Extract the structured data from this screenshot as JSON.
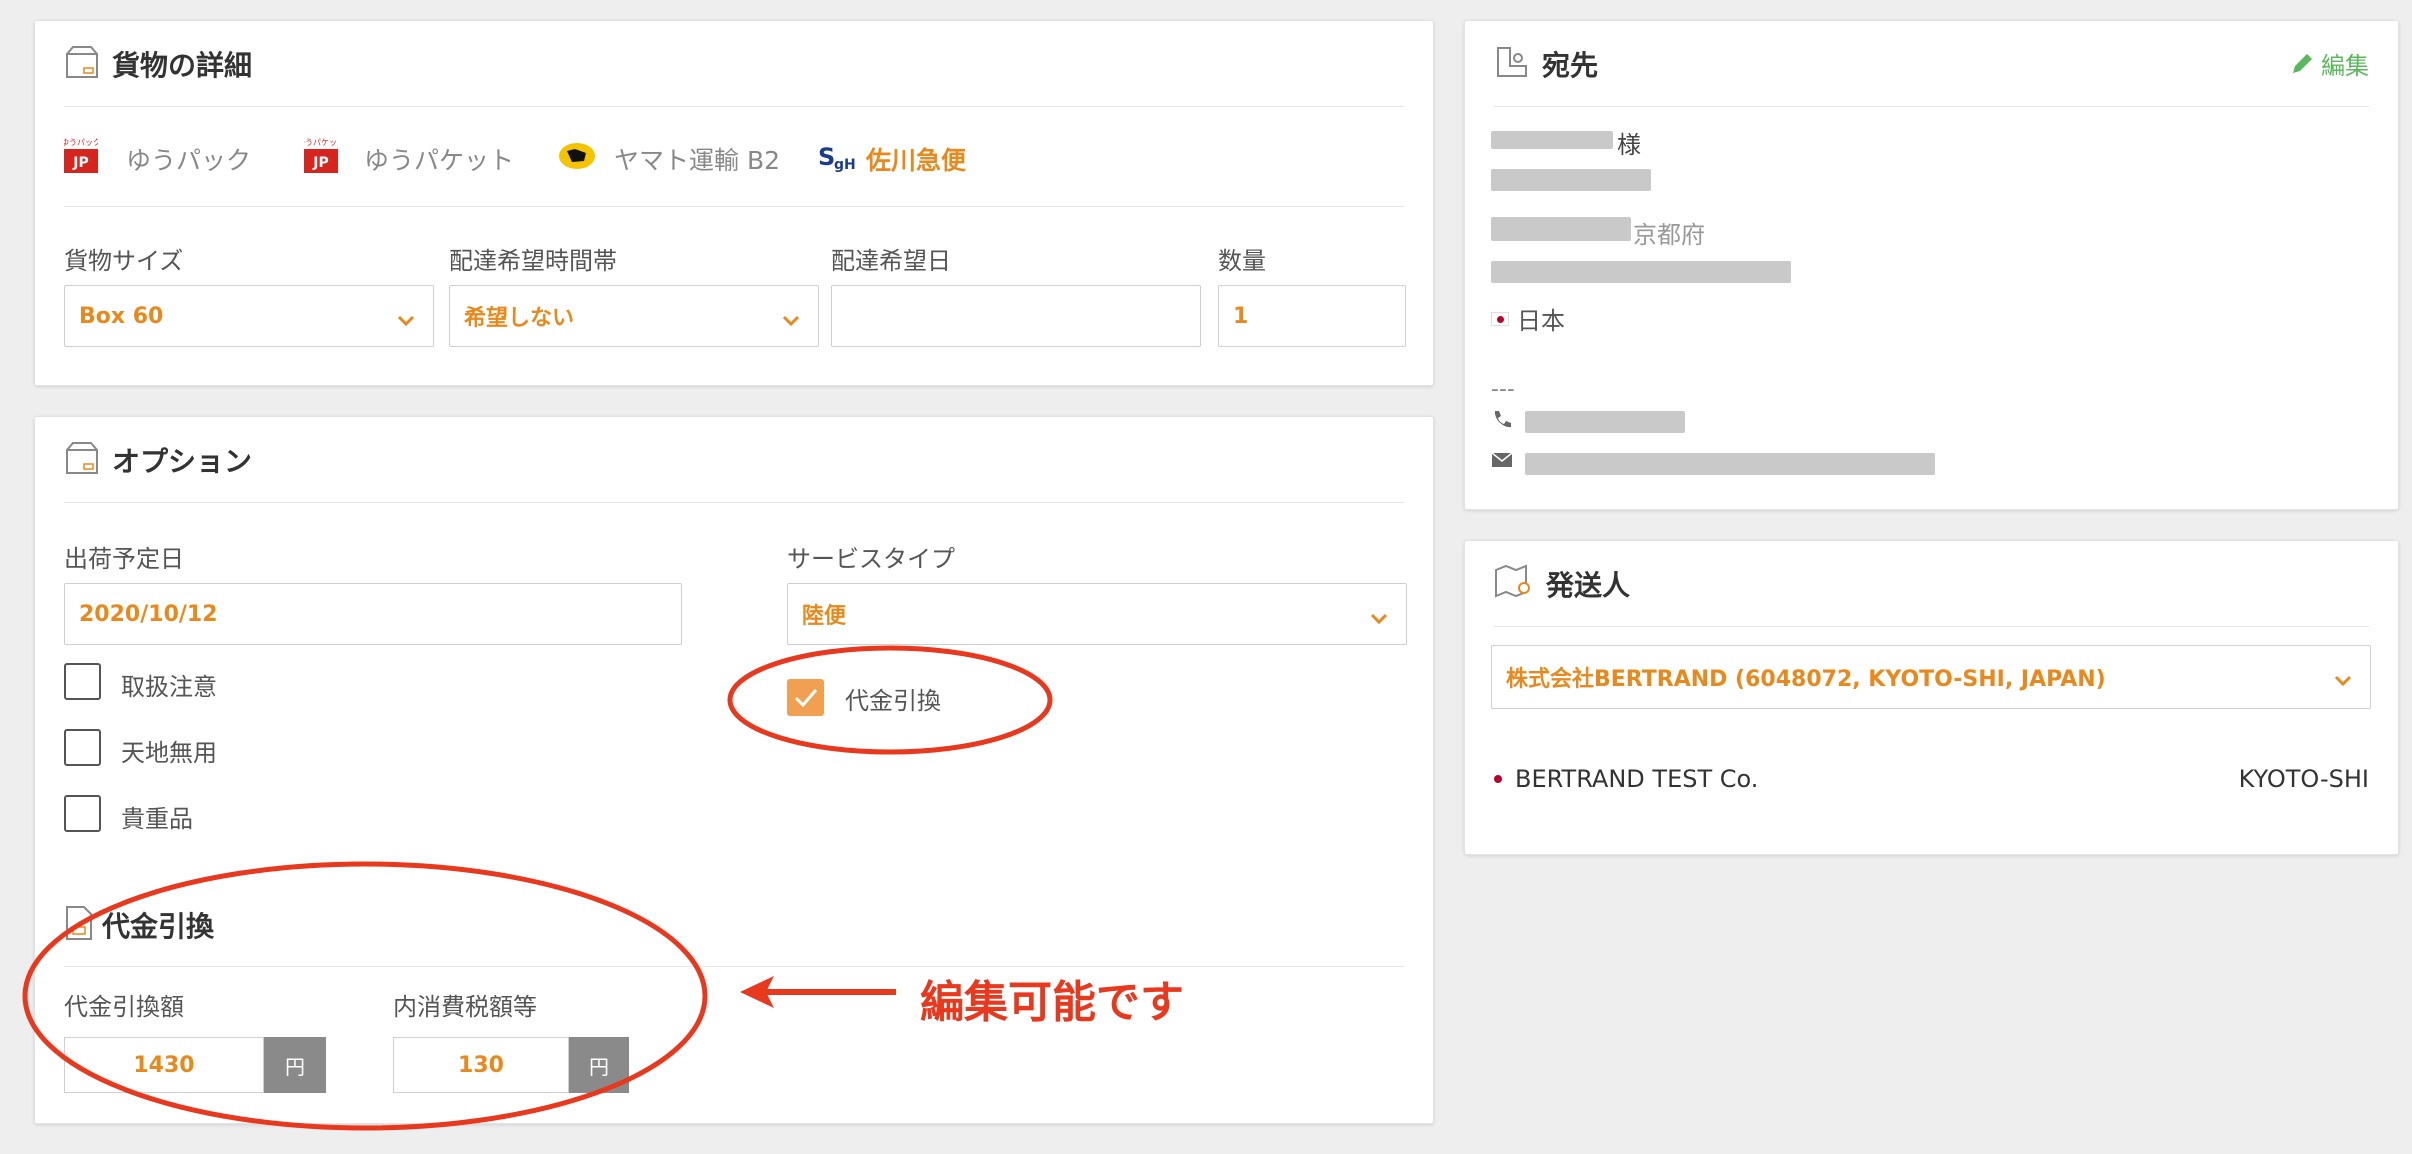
{
  "cargo": {
    "title": "貨物の詳細",
    "carriers": [
      {
        "label": "ゆうパック",
        "icon": "yu-pack-icon"
      },
      {
        "label": "ゆうパケット",
        "icon": "yu-packet-icon"
      },
      {
        "label": "ヤマト運輸 B2",
        "icon": "yamato-icon"
      },
      {
        "label": "佐川急便",
        "icon": "sagawa-icon",
        "active": true
      }
    ],
    "size_label": "貨物サイズ",
    "size_value": "Box 60",
    "time_label": "配達希望時間帯",
    "time_value": "希望しない",
    "date_label": "配達希望日",
    "date_value": "",
    "qty_label": "数量",
    "qty_value": "1"
  },
  "options": {
    "title": "オプション",
    "ship_date_label": "出荷予定日",
    "ship_date_value": "2020/10/12",
    "service_label": "サービスタイプ",
    "service_value": "陸便",
    "checkboxes": [
      {
        "label": "取扱注意",
        "checked": false
      },
      {
        "label": "天地無用",
        "checked": false
      },
      {
        "label": "貴重品",
        "checked": false
      }
    ],
    "cod_checkbox": {
      "label": "代金引換",
      "checked": true
    },
    "cod": {
      "title": "代金引換",
      "amount_label": "代金引換額",
      "amount_value": "1430",
      "tax_label": "内消費税額等",
      "tax_value": "130",
      "unit": "円"
    }
  },
  "annotation": {
    "text": "編集可能です",
    "color": "#e8381e"
  },
  "destination": {
    "title": "宛先",
    "edit_label": "編集",
    "honorific": "様",
    "postal_suffix": "京都府",
    "country": "日本",
    "separator": "---"
  },
  "sender": {
    "title": "発送人",
    "select_value": "株式会社BERTRAND (6048072, KYOTO-SHI, JAPAN)",
    "company": "BERTRAND TEST Co.",
    "city": "KYOTO-SHI"
  },
  "colors": {
    "accent": "#e8891d",
    "green": "#5cb85c",
    "japan_red": "#bc002d"
  }
}
